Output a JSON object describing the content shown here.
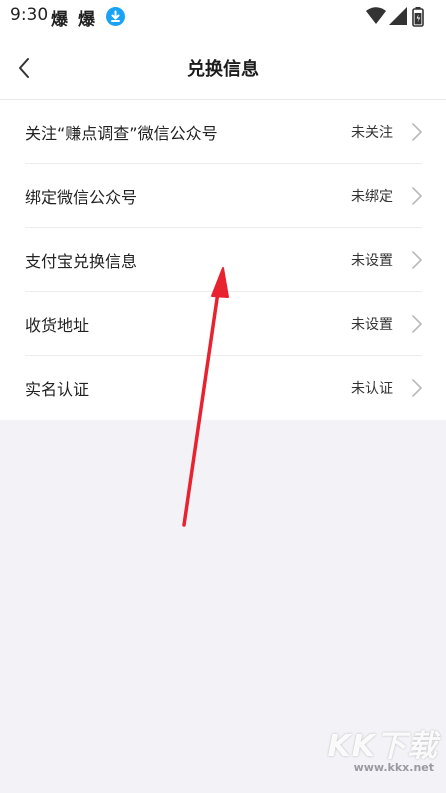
{
  "status_bar": {
    "time": "9:30",
    "app_icons": [
      "爆",
      "爆"
    ],
    "download_icon": "download-badge-icon",
    "right_icons": [
      "wifi-icon",
      "signal-icon",
      "battery-icon"
    ]
  },
  "nav": {
    "title": "兑换信息",
    "back_icon": "chevron-left-icon"
  },
  "settings": {
    "items": [
      {
        "label": "关注“赚点调查”微信公众号",
        "value": "未关注"
      },
      {
        "label": "绑定微信公众号",
        "value": "未绑定"
      },
      {
        "label": "支付宝兑换信息",
        "value": "未设置"
      },
      {
        "label": "收货地址",
        "value": "未设置"
      },
      {
        "label": "实名认证",
        "value": "未认证"
      }
    ]
  },
  "annotation": {
    "color": "#e8222e",
    "icon": "red-arrow"
  },
  "watermark": {
    "logo": "KK下载",
    "url": "www.kkx.net"
  },
  "colors": {
    "background": "#f2f2f7",
    "surface": "#ffffff",
    "download_badge": "#1aa3f5",
    "chevron": "#b9b9bf"
  }
}
